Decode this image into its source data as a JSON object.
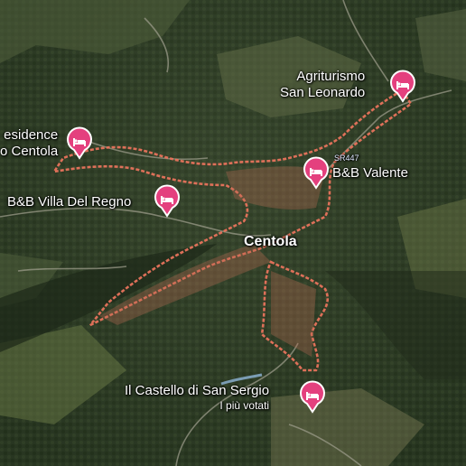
{
  "town": {
    "name": "Centola"
  },
  "road": {
    "name": "SR447"
  },
  "places": [
    {
      "id": "agriturismo",
      "line1": "Agriturismo",
      "line2": "San Leonardo",
      "type": "hotel-icon"
    },
    {
      "id": "residence",
      "line1": "esidence",
      "line2": "o Centola",
      "type": "hotel-icon"
    },
    {
      "id": "valente",
      "line1": "B&B Valente",
      "type": "hotel-icon"
    },
    {
      "id": "villa-del-regno",
      "line1": "B&B Villa Del Regno",
      "type": "hotel-icon"
    },
    {
      "id": "castello",
      "line1": "Il Castello di San Sergio",
      "sub": "I più votati",
      "type": "hotel-icon"
    }
  ],
  "colors": {
    "pin": "#e4407e",
    "boundary": "#e8735c",
    "vegetation_dark": "#26331f",
    "vegetation_mid": "#3d4f2e",
    "field": "#6f7a4a"
  }
}
